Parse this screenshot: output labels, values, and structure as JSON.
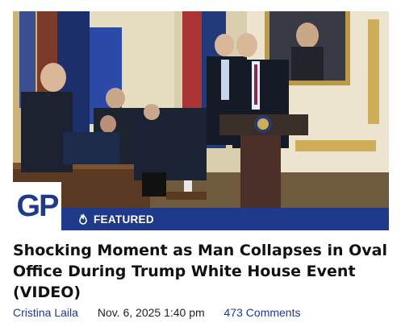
{
  "hero": {
    "alt_icon": "news-photo"
  },
  "logo": {
    "text": "GP"
  },
  "badge": {
    "label": "FEATURED",
    "icon": "flame-icon"
  },
  "headline": "Shocking Moment as Man Collapses in Oval Office During Trump White House Event (VIDEO)",
  "meta": {
    "author": "Cristina Laila",
    "date": "Nov. 6, 2025 1:40 pm",
    "comments": "473 Comments"
  },
  "colors": {
    "brand": "#1f3a8a"
  }
}
